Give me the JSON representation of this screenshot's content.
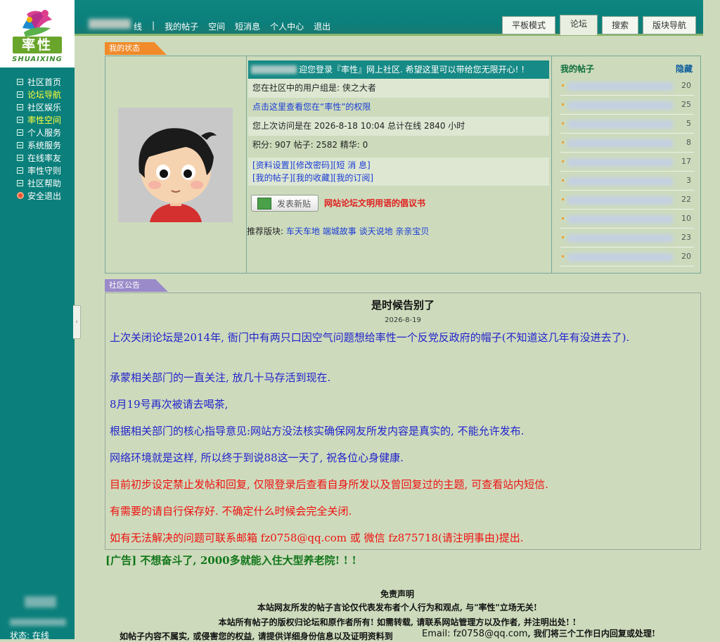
{
  "colors": {
    "teal": "#0b7f7b",
    "page_bg": "#cddbbc",
    "my_status_tab": "#f08a2a",
    "notice_tab": "#9a8ac9",
    "notice_blue": "#2222cc",
    "notice_red": "#ee1111"
  },
  "logo": {
    "cn": "率性",
    "en": "SHUAIXING"
  },
  "sidebar": {
    "items": [
      {
        "label": "社区首页",
        "icon": "minus-box-icon"
      },
      {
        "label": "论坛导航",
        "icon": "minus-box-icon",
        "highlight": true
      },
      {
        "label": "社区娱乐",
        "icon": "minus-box-icon"
      },
      {
        "label": "率性空间",
        "icon": "minus-box-icon",
        "highlight": true
      },
      {
        "label": "个人服务",
        "icon": "minus-box-icon"
      },
      {
        "label": "系统服务",
        "icon": "minus-box-icon"
      },
      {
        "label": "在线率友",
        "icon": "minus-box-icon"
      },
      {
        "label": "率性守则",
        "icon": "minus-box-icon"
      },
      {
        "label": "社区帮助",
        "icon": "minus-box-icon"
      },
      {
        "label": "安全退出",
        "icon": "exit-icon"
      }
    ],
    "status_label": "状态: 在线",
    "collapse_icon": "‹"
  },
  "topnav": {
    "online_suffix": "线",
    "links": [
      "我的帖子",
      "空间",
      "短消息",
      "个人中心",
      "退出"
    ],
    "tabs": [
      "平板模式",
      "论坛",
      "搜索",
      "版块导航"
    ],
    "active_tab": "论坛"
  },
  "my_status": {
    "tab_label": "我的状态",
    "welcome": "迎您登录『率性』网上社区. 希望这里可以带给您无限开心! !",
    "group_line": "您在社区中的用户组是: 侠之大者",
    "rights_link": "点击这里查看您在“率性”的权限",
    "last_visit": "您上次访问是在 2026-8-18 10:04 总计在线 2840 小时",
    "stats": "积分: 907 帖子: 2582 精华: 0",
    "links_row1": [
      "[资料设置]",
      "[修改密码]",
      "[短 消 息]"
    ],
    "links_row2": [
      "[我的帖子]",
      "[我的收藏]",
      "[我的订阅]"
    ],
    "post_button": "发表新贴",
    "proposal_link": "网站论坛文明用语的倡议书",
    "recommend_label": "推荐版块:",
    "recommend_boards": [
      "车天车地",
      "端城故事",
      "谈天说地",
      "亲亲宝贝"
    ]
  },
  "my_posts": {
    "title": "我的帖子",
    "hide": "隐藏",
    "counts": [
      "20",
      "25",
      "5",
      "8",
      "17",
      "3",
      "22",
      "10",
      "23",
      "20"
    ]
  },
  "notice": {
    "tab_label": "社区公告",
    "title": "是时候告别了",
    "date": "2026-8-19",
    "paragraphs": [
      "上次关闭论坛是2014年, 衙门中有两只口因空气问题想给率性一个反党反政府的帽子(不知道这几年有没进去了).",
      "承蒙相关部门的一直关注, 放几十马存活到现在.",
      "8月19号再次被请去喝茶,",
      "根据相关部门的核心指导意见:网站方没法核实确保网友所发内容是真实的, 不能允许发布.",
      "网络环境就是这样, 所以终于到说88这一天了, 祝各位心身健康."
    ],
    "red_paragraphs": [
      "目前初步设定禁止发帖和回复, 仅限登录后查看自身所发以及曾回复过的主题, 可查看站内短信.",
      "有需要的请自行保存好. 不确定什么时候会完全关闭.",
      "如有无法解决的问题可联系邮箱 fz0758@qq.com 或 微信 fz875718(请注明事由)提出."
    ]
  },
  "ad": "[广告] 不想奋斗了, 2000多就能入住大型养老院! ! !",
  "disclaimer": {
    "title": "免责声明",
    "lines": [
      "本站网友所发的帖子言论仅代表发布者个人行为和观点, 与\"率性\"立场无关!",
      "本站所有帖子的版权归论坛和原作者所有! 如需转载, 请联系网站管理方以及作者, 并注明出处! !",
      "如帖子内容不属实, 或侵害您的权益, 请提供详细身份信息以及证明资料到"
    ],
    "email": "Email: fz0758@qq.com",
    "tail": ", 我们将三个工作日内回复或处理!"
  }
}
